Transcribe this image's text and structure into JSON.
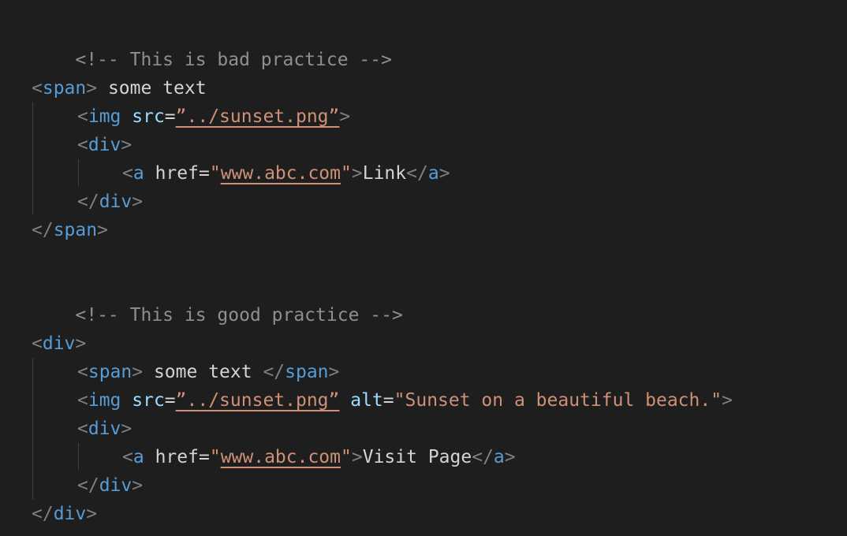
{
  "lines": {
    "l1": {
      "comment": "<!-- This is bad practice -->"
    },
    "l3": {
      "lt": "<",
      "tag": "span",
      "gt": ">",
      "text": " some text"
    },
    "l4": {
      "lt": "<",
      "tag": "img",
      "attr": " src",
      "eq": "=",
      "q1": "”",
      "val": "../sunset.png",
      "q2": "”",
      "gt": ">"
    },
    "l5": {
      "lt": "<",
      "tag": "div",
      "gt": ">"
    },
    "l6": {
      "lt": "<",
      "tag": "a",
      "attr": " href",
      "eq": "=",
      "q1": "\"",
      "val": "www.abc.com",
      "q2": "\"",
      "gt": ">",
      "text": "Link",
      "elt": "</",
      "etag": "a",
      "egt": ">"
    },
    "l7": {
      "lt": "</",
      "tag": "div",
      "gt": ">"
    },
    "l8": {
      "lt": "</",
      "tag": "span",
      "gt": ">"
    },
    "l10": {
      "comment": "<!-- This is good practice -->"
    },
    "l12": {
      "lt": "<",
      "tag": "div",
      "gt": ">"
    },
    "l13": {
      "lt": "<",
      "tag": "span",
      "gt": ">",
      "text": " some text ",
      "elt": "</",
      "etag": "span",
      "egt": ">"
    },
    "l14": {
      "lt": "<",
      "tag": "img",
      "attr": " src",
      "eq": "=",
      "q1": "”",
      "val": "../sunset.png",
      "q2": "”",
      "attr2": " alt",
      "eq2": "=",
      "q3": "\"",
      "val2": "Sunset on a beautiful beach.",
      "q4": "\"",
      "gt": ">"
    },
    "l15": {
      "lt": "<",
      "tag": "div",
      "gt": ">"
    },
    "l16": {
      "lt": "<",
      "tag": "a",
      "attr": " href",
      "eq": "=",
      "q1": "\"",
      "val": "www.abc.com",
      "q2": "\"",
      "gt": ">",
      "text": "Visit Page",
      "elt": "</",
      "etag": "a",
      "egt": ">"
    },
    "l17": {
      "lt": "</",
      "tag": "div",
      "gt": ">"
    },
    "l18": {
      "lt": "</",
      "tag": "div",
      "gt": ">"
    }
  },
  "colors": {
    "background": "#1e1e1e",
    "tag": "#569cd6",
    "attribute": "#9cdcfe",
    "string": "#ce9178",
    "comment": "#8f8f8f",
    "text": "#d4d4d4"
  }
}
